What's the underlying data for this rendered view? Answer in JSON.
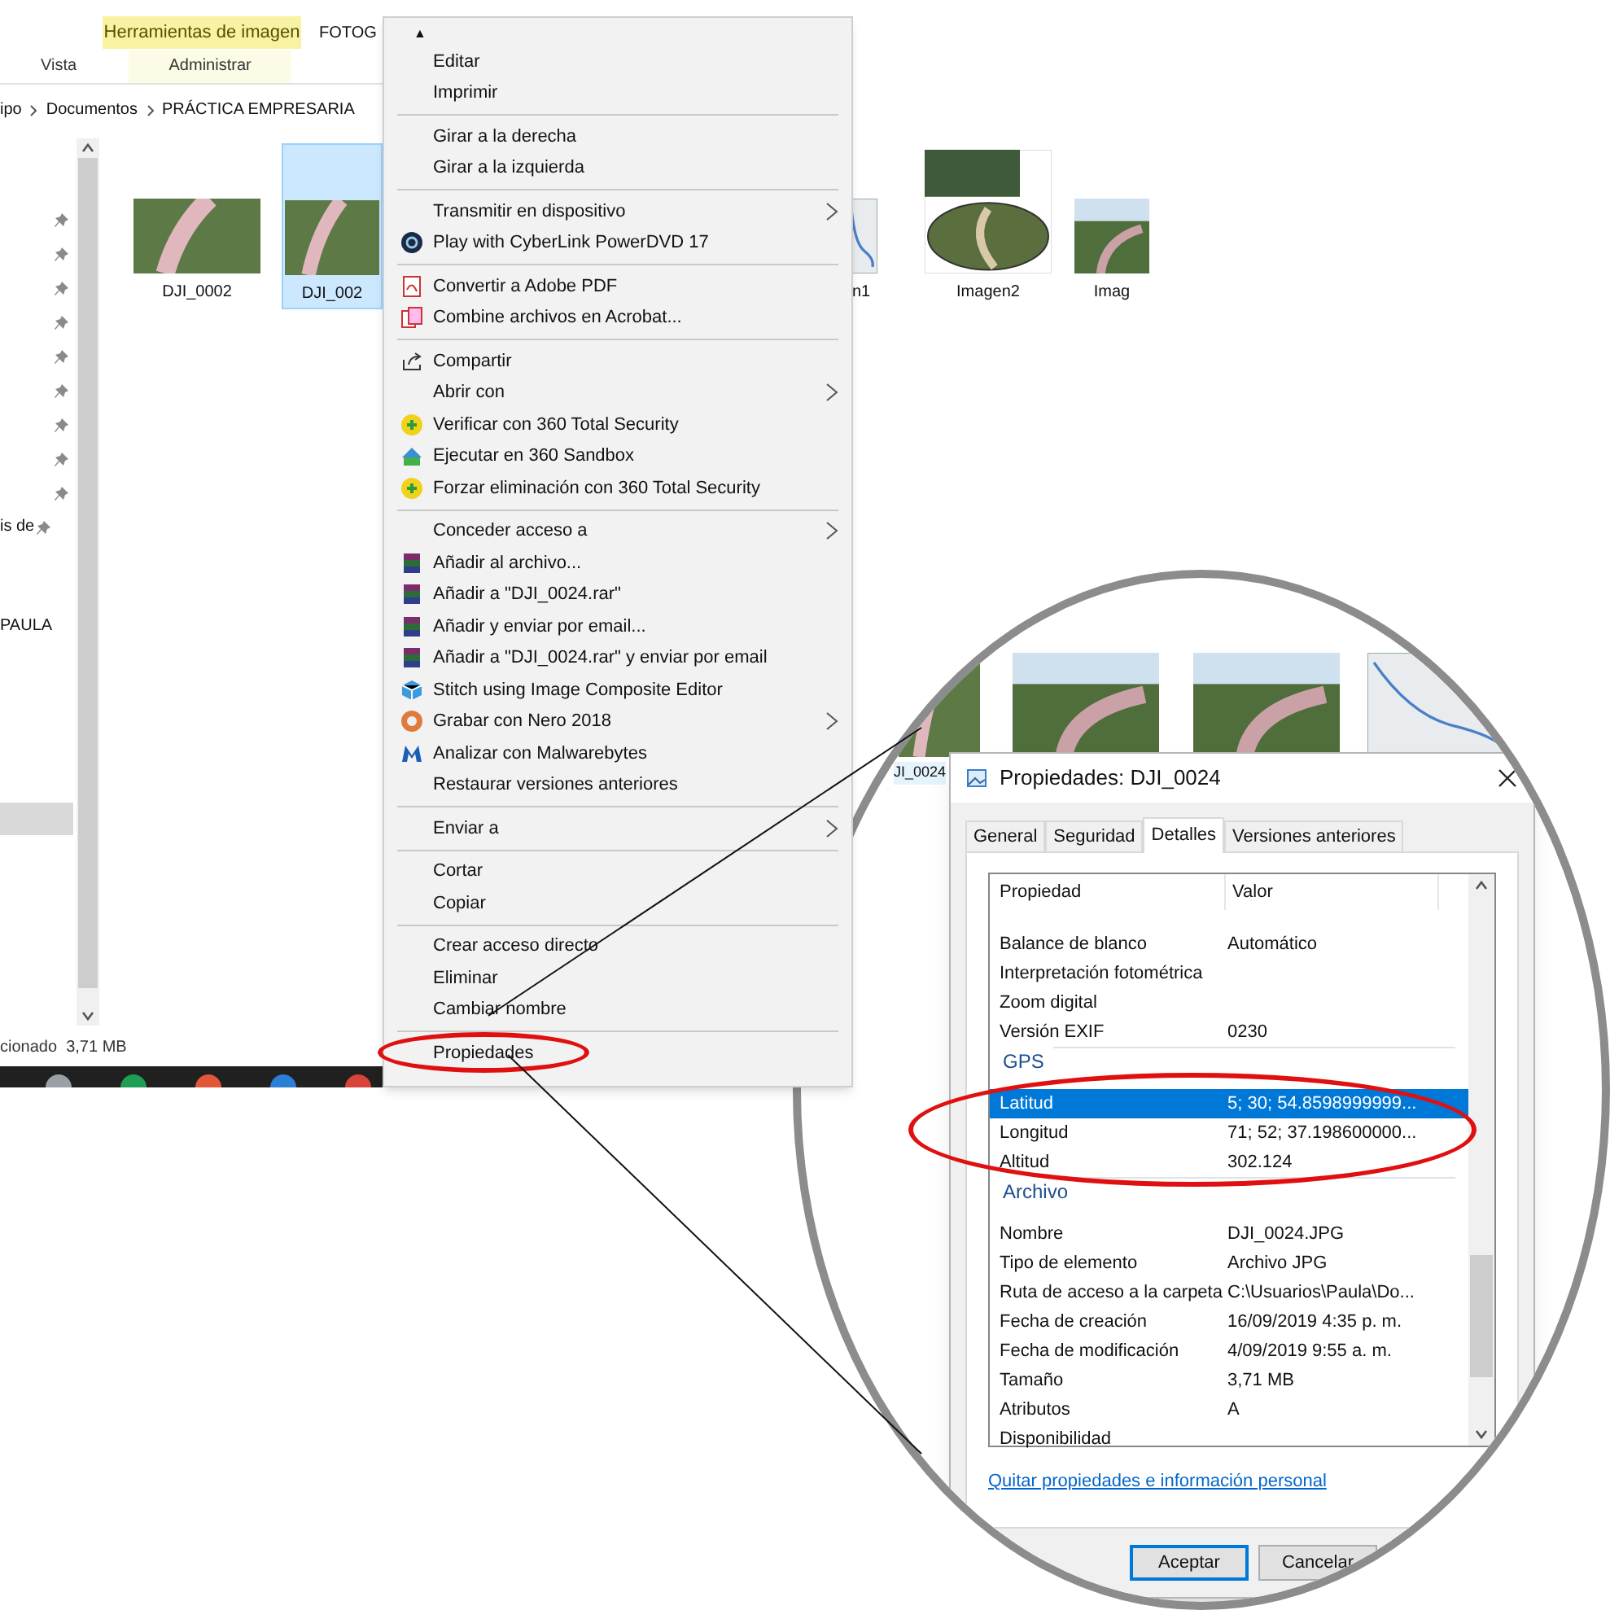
{
  "explorer": {
    "ribbon": {
      "context_tab": "Herramientas de imagen",
      "title_fragment": "FOTOG",
      "tabs": [
        {
          "label": "Vista"
        },
        {
          "label": "Administrar"
        }
      ]
    },
    "breadcrumb": [
      "ipo",
      "Documentos",
      "PRÁCTICA EMPRESARIA"
    ],
    "nav_items": [
      {
        "label": "is de",
        "pinned": true
      },
      {
        "label": "PAULA",
        "pinned": false
      }
    ],
    "files": [
      {
        "name": "DJI_0002",
        "kind": "aerial",
        "selected": false
      },
      {
        "name": "DJI_002",
        "kind": "aerial",
        "selected": true
      },
      {
        "name": "n1",
        "kind": "map",
        "selected": false
      },
      {
        "name": "Imagen2",
        "kind": "collage",
        "selected": false
      },
      {
        "name": "Imag",
        "kind": "river",
        "selected": false
      }
    ],
    "status_bar": "cionado  3,71 MB"
  },
  "context_menu": {
    "scroll_up": "▲",
    "groups": [
      [
        {
          "label": "Editar",
          "kind": "plain",
          "submenu": false
        },
        {
          "label": "Imprimir",
          "kind": "plain",
          "submenu": false
        }
      ],
      [
        {
          "label": "Girar a la derecha",
          "kind": "plain",
          "submenu": false
        },
        {
          "label": "Girar a la izquierda",
          "kind": "plain",
          "submenu": false
        }
      ],
      [
        {
          "label": "Transmitir en dispositivo",
          "kind": "plain",
          "submenu": true
        },
        {
          "label": "Play with CyberLink PowerDVD 17",
          "kind": "player",
          "submenu": false
        }
      ],
      [
        {
          "label": "Convertir a Adobe PDF",
          "kind": "pdf",
          "submenu": false
        },
        {
          "label": "Combine archivos en Acrobat...",
          "kind": "acrobat",
          "submenu": false
        }
      ],
      [
        {
          "label": "Compartir",
          "kind": "share",
          "submenu": false
        },
        {
          "label": "Abrir con",
          "kind": "plain",
          "submenu": true
        },
        {
          "label": "Verificar con 360 Total Security",
          "kind": "shield",
          "submenu": false
        },
        {
          "label": "Ejecutar en 360 Sandbox",
          "kind": "sandbox",
          "submenu": false
        },
        {
          "label": "Forzar eliminación con 360 Total Security",
          "kind": "shield",
          "submenu": false
        }
      ],
      [
        {
          "label": "Conceder acceso a",
          "kind": "plain",
          "submenu": true
        },
        {
          "label": "Añadir al archivo...",
          "kind": "archive",
          "submenu": false
        },
        {
          "label": "Añadir a \"DJI_0024.rar\"",
          "kind": "archive",
          "submenu": false
        },
        {
          "label": "Añadir y enviar por email...",
          "kind": "archive",
          "submenu": false
        },
        {
          "label": "Añadir a \"DJI_0024.rar\" y enviar por email",
          "kind": "archive",
          "submenu": false
        },
        {
          "label": "Stitch using Image Composite Editor",
          "kind": "cube",
          "submenu": false
        },
        {
          "label": "Grabar con Nero 2018",
          "kind": "disc",
          "submenu": true
        },
        {
          "label": "Analizar con Malwarebytes",
          "kind": "malware",
          "submenu": false
        },
        {
          "label": "Restaurar versiones anteriores",
          "kind": "plain",
          "submenu": false
        }
      ],
      [
        {
          "label": "Enviar a",
          "kind": "plain",
          "submenu": true
        }
      ],
      [
        {
          "label": "Cortar",
          "kind": "plain",
          "submenu": false
        },
        {
          "label": "Copiar",
          "kind": "plain",
          "submenu": false
        }
      ],
      [
        {
          "label": "Crear acceso directo",
          "kind": "plain",
          "submenu": false
        },
        {
          "label": "Eliminar",
          "kind": "plain",
          "submenu": false
        },
        {
          "label": "Cambiar nombre",
          "kind": "plain",
          "submenu": false
        }
      ],
      [
        {
          "label": "Propiedades",
          "kind": "plain",
          "submenu": false,
          "highlighted": true
        }
      ]
    ]
  },
  "magnifier": {
    "thumbnails": [
      {
        "kind": "aerial"
      },
      {
        "kind": "river"
      },
      {
        "kind": "river"
      },
      {
        "kind": "map"
      }
    ],
    "thumbnail_label": "JI_0024",
    "dialog": {
      "title": "Propiedades: DJI_0024",
      "tabs": [
        {
          "label": "General",
          "selected": false
        },
        {
          "label": "Seguridad",
          "selected": false
        },
        {
          "label": "Detalles",
          "selected": true
        },
        {
          "label": "Versiones anteriores",
          "selected": false
        }
      ],
      "columns": [
        "Propiedad",
        "Valor"
      ],
      "sections": [
        {
          "highlighted": false,
          "rows": [
            {
              "property": "Balance de blanco",
              "value": "Automático",
              "selected": false
            },
            {
              "property": "Interpretación fotométrica",
              "selected": false
            },
            {
              "property": "Zoom digital",
              "selected": false
            },
            {
              "property": "Versión EXIF",
              "value": "0230",
              "selected": false
            }
          ]
        },
        {
          "title": "GPS",
          "highlighted": true,
          "rows": [
            {
              "property": "Latitud",
              "value": "5; 30; 54.8598999999...",
              "selected": true
            },
            {
              "property": "Longitud",
              "value": "71; 52; 37.198600000...",
              "selected": false
            },
            {
              "property": "Altitud",
              "value": "302.124",
              "selected": false
            }
          ]
        },
        {
          "title": "Archivo",
          "highlighted": false,
          "rows": [
            {
              "property": "Nombre",
              "value": "DJI_0024.JPG",
              "selected": false
            },
            {
              "property": "Tipo de elemento",
              "value": "Archivo JPG",
              "selected": false
            },
            {
              "property": "Ruta de acceso a la carpeta",
              "value": "C:\\Usuarios\\Paula\\Do...",
              "selected": false
            },
            {
              "property": "Fecha de creación",
              "value": "16/09/2019 4:35 p. m.",
              "selected": false
            },
            {
              "property": "Fecha de modificación",
              "value": "4/09/2019 9:55 a. m.",
              "selected": false
            },
            {
              "property": "Tamaño",
              "value": "3,71 MB",
              "selected": false
            },
            {
              "property": "Atributos",
              "value": "A",
              "selected": false
            },
            {
              "property": "Disponibilidad",
              "selected": false
            }
          ]
        }
      ],
      "link": "Quitar propiedades e información personal",
      "buttons": [
        {
          "label": "Aceptar",
          "default": true
        },
        {
          "label": "Cancelar",
          "default": false
        }
      ]
    }
  }
}
